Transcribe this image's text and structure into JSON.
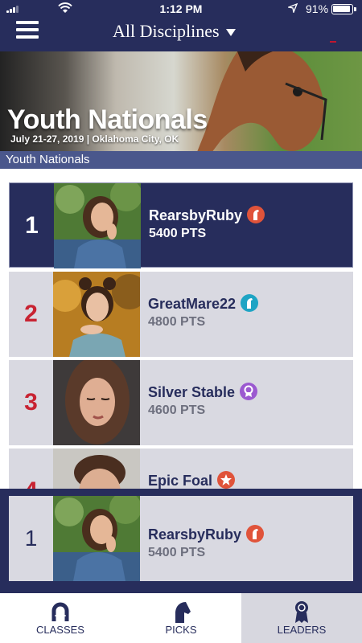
{
  "status_bar": {
    "time": "1:12 PM",
    "battery": "91%"
  },
  "nav": {
    "discipline": "All Disciplines"
  },
  "banner": {
    "title": "Youth Nationals",
    "subtitle": "July 21-27, 2019 | Oklahoma City, OK"
  },
  "section": {
    "label": "Youth Nationals"
  },
  "leaders": [
    {
      "rank": "1",
      "name": "RearsbyRuby",
      "points": "5400 PTS",
      "badge_icon": "horse-icon",
      "badge_color": "#e0533a"
    },
    {
      "rank": "2",
      "name": "GreatMare22",
      "points": "4800 PTS",
      "badge_icon": "horse-icon",
      "badge_color": "#1ea4c4"
    },
    {
      "rank": "3",
      "name": "Silver Stable",
      "points": "4600 PTS",
      "badge_icon": "ribbon-icon",
      "badge_color": "#9b59d0"
    },
    {
      "rank": "4",
      "name": "Epic Foal",
      "points": "",
      "badge_icon": "star-icon",
      "badge_color": "#e0533a"
    }
  ],
  "current_user": {
    "rank": "1",
    "name": "RearsbyRuby",
    "points": "5400 PTS",
    "badge_icon": "horse-icon",
    "badge_color": "#e0533a"
  },
  "tabs": [
    {
      "label": "CLASSES",
      "icon": "horseshoe-icon",
      "active": false
    },
    {
      "label": "PICKS",
      "icon": "horse-head-icon",
      "active": false
    },
    {
      "label": "LEADERS",
      "icon": "award-icon",
      "active": true
    }
  ],
  "colors": {
    "navy": "#272d5c",
    "rank_red": "#c82332",
    "row_gray": "#d9d9e1"
  }
}
